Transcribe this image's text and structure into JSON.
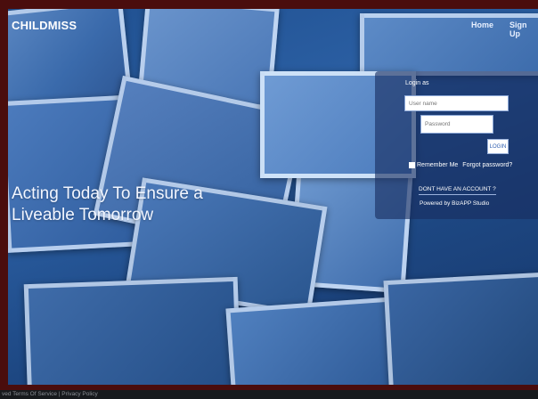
{
  "header": {
    "brand": "CHILDMISS",
    "nav": {
      "home": "Home",
      "signup": "Sign Up"
    }
  },
  "hero": {
    "line1": "Acting Today To Ensure a",
    "line2": "Liveable Tomorrow"
  },
  "login": {
    "title": "Login as",
    "username_placeholder": "User name",
    "password_placeholder": "Password",
    "button": "LOGIN",
    "remember": "Remember Me",
    "forgot": "Forgot password?",
    "no_account": "DONT HAVE AN ACCOUNT ?",
    "powered_by": "Powered by BizAPP Studio"
  },
  "footer": {
    "text": "ved Terms Of Service | Privacy Policy"
  },
  "colors": {
    "page_border": "#4a0d0d",
    "overlay": "#1f4f8f",
    "panel": "#192d5f"
  }
}
